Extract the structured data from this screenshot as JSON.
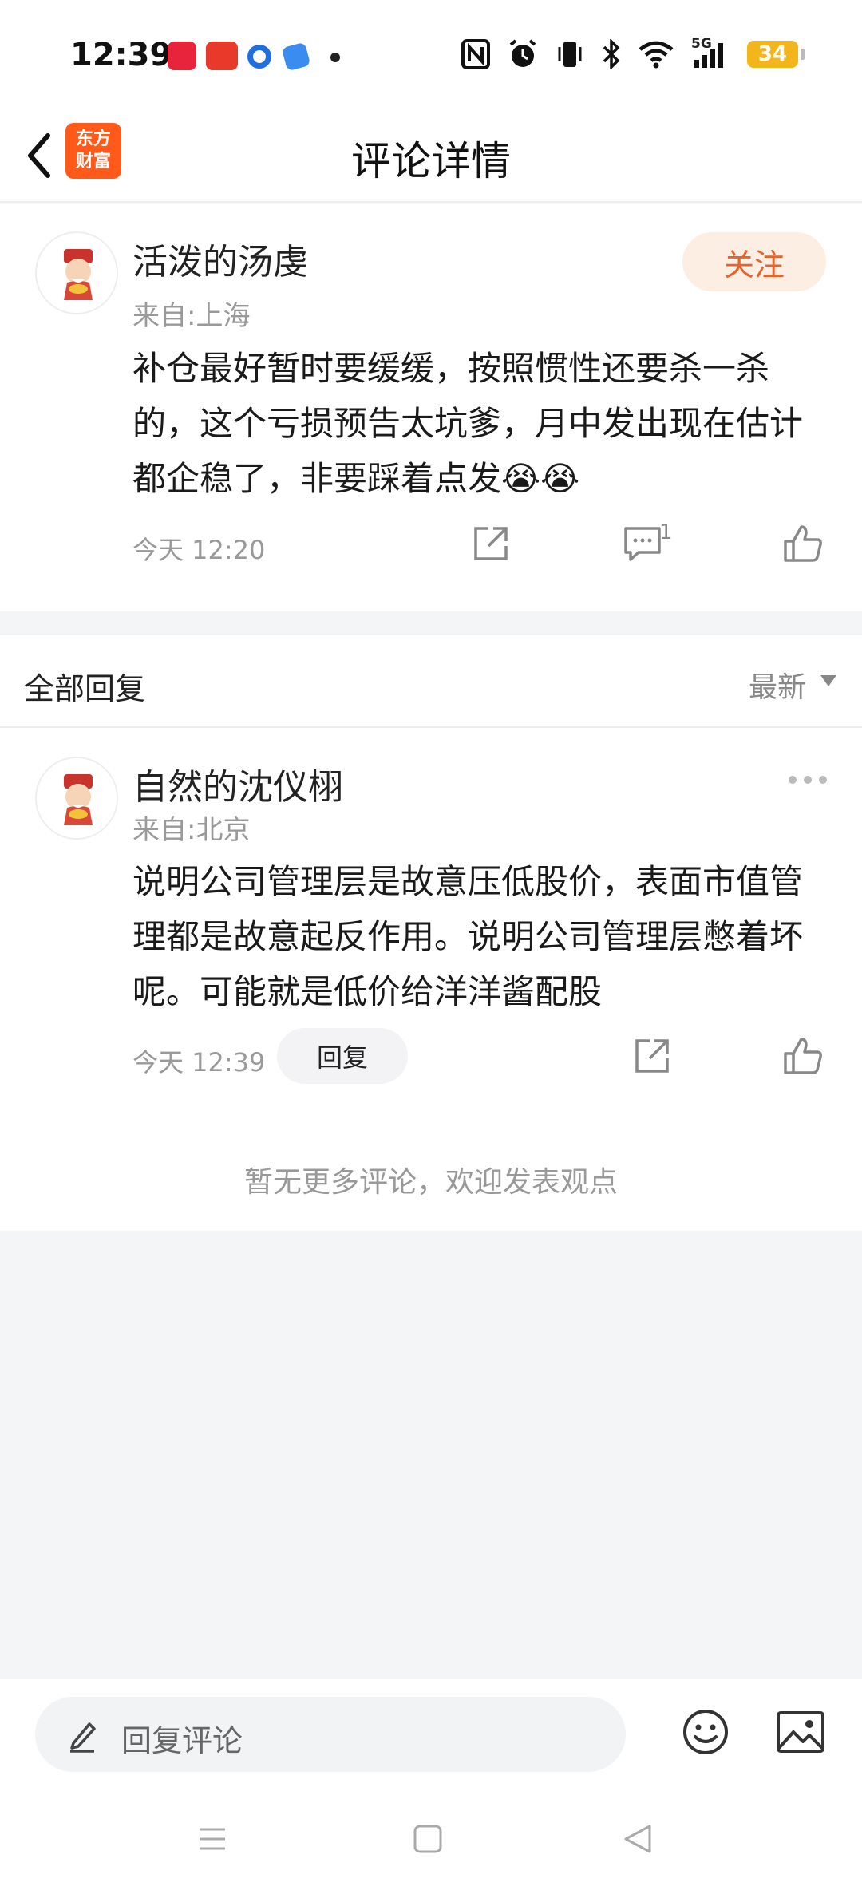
{
  "status_bar": {
    "time": "12:39",
    "battery": "34",
    "network": "5G",
    "icons": [
      "nfc-icon",
      "alarm-icon",
      "vibrate-icon",
      "bluetooth-icon",
      "wifi-icon",
      "signal-icon",
      "battery-icon"
    ]
  },
  "header": {
    "title": "评论详情",
    "logo_line1": "东方",
    "logo_line2": "财富",
    "accent_color": "#ff5a1a"
  },
  "main_comment": {
    "username": "活泼的汤虔",
    "location": "来自:上海",
    "follow_label": "关注",
    "content": "补仓最好暂时要缓缓，按照惯性还要杀一杀的，这个亏损预告太坑爹，月中发出现在估计都企稳了，非要踩着点发😭😭",
    "time": "今天 12:20",
    "comment_count": "1"
  },
  "replies": {
    "title": "全部回复",
    "sort_label": "最新",
    "items": [
      {
        "username": "自然的沈仪栩",
        "location": "来自:北京",
        "content": "说明公司管理层是故意压低股价，表面市值管理都是故意起反作用。说明公司管理层憋着坏呢。可能就是低价给洋洋酱配股",
        "time": "今天 12:39",
        "reply_label": "回复"
      }
    ],
    "no_more": "暂无更多评论，欢迎发表观点"
  },
  "bottom_bar": {
    "input_placeholder": "回复评论"
  }
}
